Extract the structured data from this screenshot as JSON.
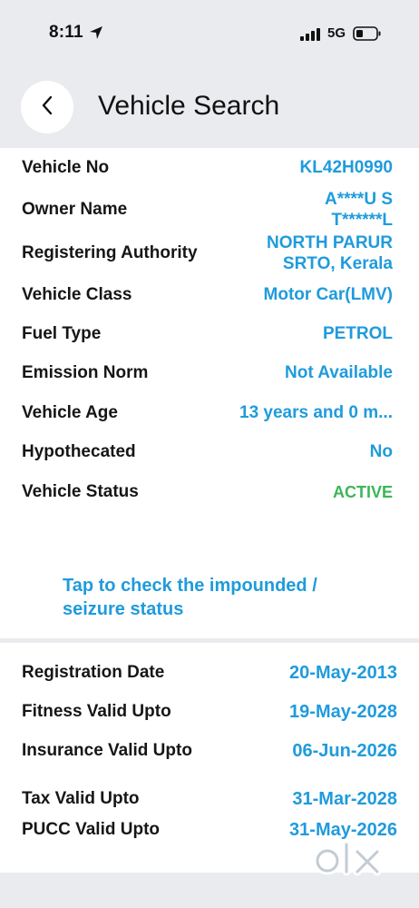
{
  "status_bar": {
    "time": "8:11",
    "network": "5G"
  },
  "header": {
    "title": "Vehicle Search"
  },
  "vehicle_details": [
    {
      "label": "Vehicle No",
      "value": "KL42H0990"
    },
    {
      "label": "Owner Name",
      "value_line1": "A****U S",
      "value_line2": "T******L"
    },
    {
      "label": "Registering Authority",
      "value_line1": "NORTH PARUR",
      "value_line2": "SRTO, Kerala"
    },
    {
      "label": "Vehicle Class",
      "value": "Motor Car(LMV)"
    },
    {
      "label": "Fuel Type",
      "value": "PETROL"
    },
    {
      "label": "Emission Norm",
      "value": "Not Available"
    },
    {
      "label": "Vehicle Age",
      "value": "13 years and 0 m..."
    },
    {
      "label": "Hypothecated",
      "value": "No"
    },
    {
      "label": "Vehicle Status",
      "value": "ACTIVE"
    }
  ],
  "impound_link": {
    "line1": "Tap to check the impounded /",
    "line2": "seizure status"
  },
  "validity": [
    {
      "label": "Registration Date",
      "value": "20-May-2013"
    },
    {
      "label": "Fitness Valid Upto",
      "value": "19-May-2028"
    },
    {
      "label": "Insurance Valid Upto",
      "value": "06-Jun-2026"
    },
    {
      "label": "Tax Valid Upto",
      "value": "31-Mar-2028"
    },
    {
      "label": "PUCC Valid Upto",
      "value": "31-May-2026"
    }
  ],
  "watermark": {
    "text": "OLX",
    "icon": "olx-logo-icon"
  },
  "colors": {
    "accent": "#1f9bdc",
    "active": "#3cb658",
    "background": "#e9ebee"
  }
}
